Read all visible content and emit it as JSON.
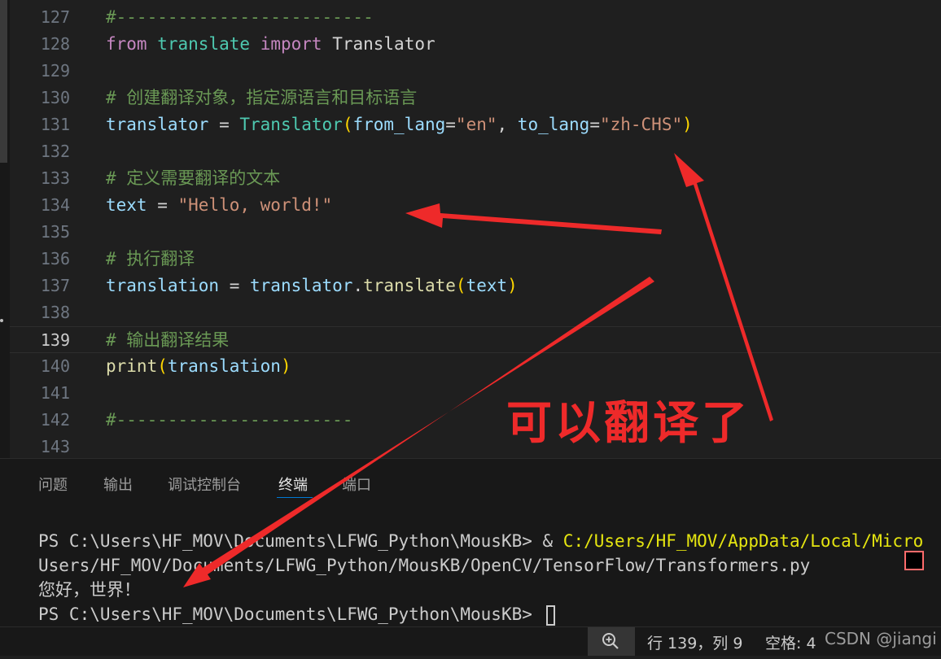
{
  "editor": {
    "lines": [
      {
        "num": "127",
        "tokens": [
          {
            "t": "#-------------------------",
            "c": "cmt"
          }
        ]
      },
      {
        "num": "128",
        "tokens": [
          {
            "t": "from",
            "c": "kw"
          },
          {
            "t": " ",
            "c": "op"
          },
          {
            "t": "translate",
            "c": "mod"
          },
          {
            "t": " ",
            "c": "op"
          },
          {
            "t": "import",
            "c": "kw"
          },
          {
            "t": " Translator",
            "c": "op"
          }
        ]
      },
      {
        "num": "129",
        "tokens": []
      },
      {
        "num": "130",
        "tokens": [
          {
            "t": "# ",
            "c": "cmt"
          },
          {
            "t": "创建翻译对象，指定源语言和目标语言",
            "c": "cmt-cn"
          }
        ]
      },
      {
        "num": "131",
        "tokens": [
          {
            "t": "translator",
            "c": "var"
          },
          {
            "t": " = ",
            "c": "op"
          },
          {
            "t": "Translator",
            "c": "cls"
          },
          {
            "t": "(",
            "c": "paren"
          },
          {
            "t": "from_lang",
            "c": "var"
          },
          {
            "t": "=",
            "c": "op"
          },
          {
            "t": "\"en\"",
            "c": "str"
          },
          {
            "t": ", ",
            "c": "op"
          },
          {
            "t": "to_lang",
            "c": "var"
          },
          {
            "t": "=",
            "c": "op"
          },
          {
            "t": "\"zh-CHS\"",
            "c": "str"
          },
          {
            "t": ")",
            "c": "paren"
          }
        ]
      },
      {
        "num": "132",
        "tokens": []
      },
      {
        "num": "133",
        "tokens": [
          {
            "t": "# ",
            "c": "cmt"
          },
          {
            "t": "定义需要翻译的文本",
            "c": "cmt-cn"
          }
        ]
      },
      {
        "num": "134",
        "tokens": [
          {
            "t": "text",
            "c": "var"
          },
          {
            "t": " = ",
            "c": "op"
          },
          {
            "t": "\"Hello, world!\"",
            "c": "str"
          }
        ]
      },
      {
        "num": "135",
        "tokens": []
      },
      {
        "num": "136",
        "tokens": [
          {
            "t": "# ",
            "c": "cmt"
          },
          {
            "t": "执行翻译",
            "c": "cmt-cn"
          }
        ]
      },
      {
        "num": "137",
        "tokens": [
          {
            "t": "translation",
            "c": "var"
          },
          {
            "t": " = ",
            "c": "op"
          },
          {
            "t": "translator",
            "c": "var"
          },
          {
            "t": ".",
            "c": "op"
          },
          {
            "t": "translate",
            "c": "fn"
          },
          {
            "t": "(",
            "c": "paren"
          },
          {
            "t": "text",
            "c": "var"
          },
          {
            "t": ")",
            "c": "paren"
          }
        ]
      },
      {
        "num": "138",
        "tokens": []
      },
      {
        "num": "139",
        "active": true,
        "tokens": [
          {
            "t": "# ",
            "c": "cmt"
          },
          {
            "t": "输出翻译结果",
            "c": "cmt-cn"
          }
        ]
      },
      {
        "num": "140",
        "tokens": [
          {
            "t": "print",
            "c": "fn"
          },
          {
            "t": "(",
            "c": "paren"
          },
          {
            "t": "translation",
            "c": "var"
          },
          {
            "t": ")",
            "c": "paren"
          }
        ]
      },
      {
        "num": "141",
        "tokens": []
      },
      {
        "num": "142",
        "tokens": [
          {
            "t": "#-----------------------",
            "c": "cmt"
          }
        ]
      },
      {
        "num": "143",
        "tokens": []
      }
    ]
  },
  "panel": {
    "tabs": [
      "问题",
      "输出",
      "调试控制台",
      "终端",
      "端口"
    ],
    "active_tab": "终端",
    "terminal": {
      "line1_prompt": "PS C:\\Users\\HF_MOV\\Documents\\LFWG_Python\\MousKB> & ",
      "line1_path": "C:/Users/HF_MOV/AppData/Local/Micro",
      "line2": "Users/HF_MOV/Documents/LFWG_Python/MousKB/OpenCV/TensorFlow/Transformers.py",
      "line3": "您好，世界！",
      "line4": "PS C:\\Users\\HF_MOV\\Documents\\LFWG_Python\\MousKB> "
    }
  },
  "statusbar": {
    "position": "行 139，列 9",
    "indent": "空格: 4",
    "watermark": "CSDN @jiangi"
  },
  "annotation": {
    "text": "可以翻译了",
    "color": "#ee2a2a"
  },
  "colors": {
    "editor_bg": "#1f1f1f",
    "panel_bg": "#181818",
    "accent": "#0078d4"
  }
}
